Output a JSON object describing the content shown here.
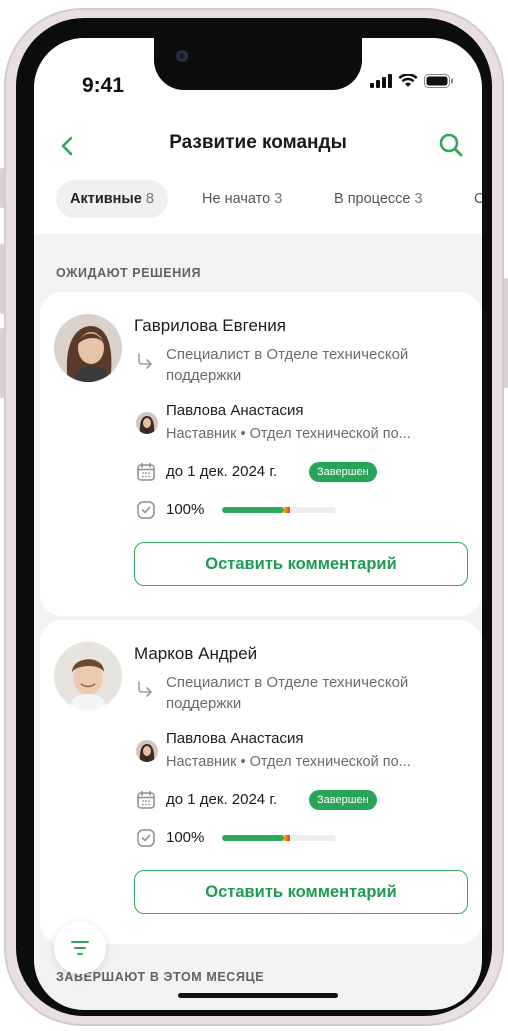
{
  "status_bar": {
    "time": "9:41",
    "icons": [
      "signal-icon",
      "wifi-icon",
      "battery-icon"
    ]
  },
  "nav": {
    "title": "Развитие команды",
    "back_icon": "chevron-left-icon",
    "search_icon": "search-icon"
  },
  "tabs": [
    {
      "label": "Активные",
      "count": "8",
      "active": true
    },
    {
      "label": "Не начато",
      "count": "3",
      "active": false
    },
    {
      "label": "В процессе",
      "count": "3",
      "active": false
    },
    {
      "label": "С",
      "count": "",
      "active": false
    }
  ],
  "sections": {
    "awaiting": "ОЖИДАЮТ РЕШЕНИЯ",
    "ending_this_month": "ЗАВЕРШАЮТ В ЭТОМ МЕСЯЦЕ"
  },
  "cards": [
    {
      "name": "Гаврилова Евгения",
      "position": "Специалист в Отделе технической поддержки",
      "mentor_name": "Павлова Анастасия",
      "mentor_role": "Наставник • Отдел технической по...",
      "due_prefix": "до",
      "due_date": "1 дек. 2024 г.",
      "status_badge": "Завершен",
      "progress_label": "100%",
      "progress": 1.0,
      "comment_button": "Оставить комментарий"
    },
    {
      "name": "Марков Андрей",
      "position": "Специалист в Отделе технической поддержки",
      "mentor_name": "Павлова Анастасия",
      "mentor_role": "Наставник • Отдел технической по...",
      "due_prefix": "до",
      "due_date": "1 дек. 2024 г.",
      "status_badge": "Завершен",
      "progress_label": "100%",
      "progress": 1.0,
      "comment_button": "Оставить комментарий"
    }
  ],
  "fab": {
    "icon": "filter-icon"
  },
  "colors": {
    "accent": "#2fa85c",
    "badge": "#27a35a",
    "background": "#f3f3f4"
  }
}
